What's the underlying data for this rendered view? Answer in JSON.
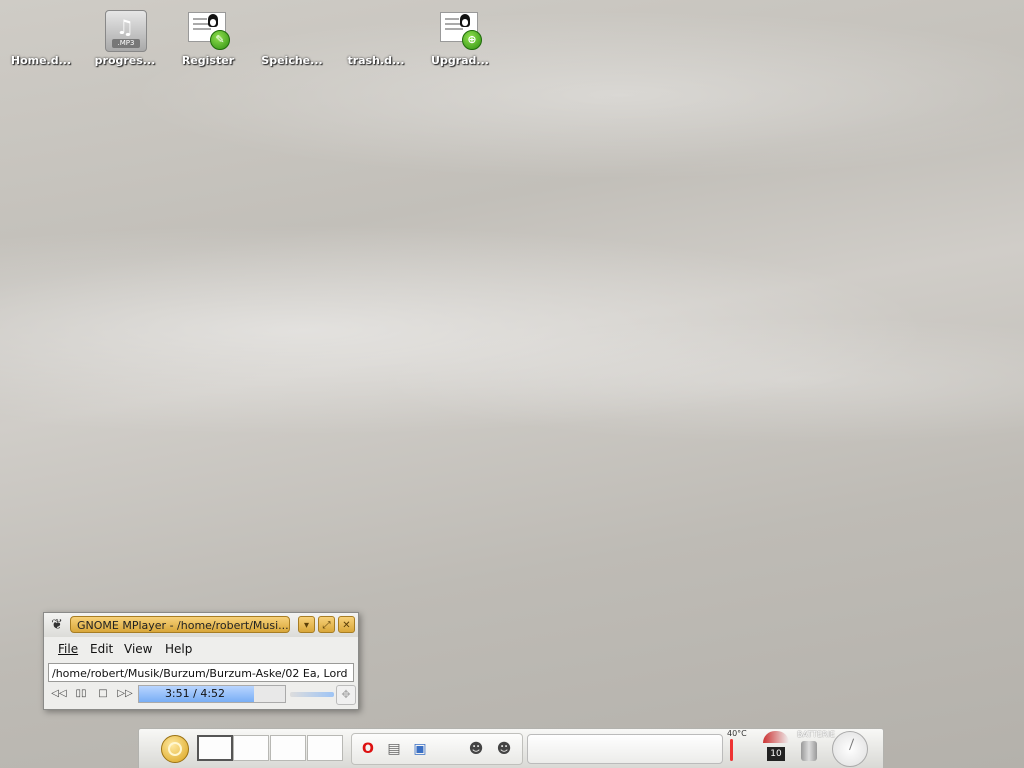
{
  "desktop": {
    "icons": [
      {
        "label": "Home.d...",
        "icon": "home-icon"
      },
      {
        "label": "progres...",
        "icon": "mp3-file-icon",
        "tag": ".MP3"
      },
      {
        "label": "Register",
        "icon": "register-icon"
      },
      {
        "label": "Speiche...",
        "icon": "storage-icon"
      },
      {
        "label": "trash.d...",
        "icon": "trash-icon"
      },
      {
        "label": "Upgrad...",
        "icon": "upgrade-icon"
      }
    ]
  },
  "mplayer": {
    "title": "GNOME MPlayer - /home/robert/Musi...",
    "menu": {
      "file": "File",
      "edit": "Edit",
      "view": "View",
      "help": "Help"
    },
    "path": "/home/robert/Musik/Burzum/Burzum-Aske/02 Ea, Lord",
    "time_display": "3:51 /  4:52",
    "progress_fraction": 0.787,
    "controls": [
      "rewind-icon",
      "pause-icon",
      "stop-icon",
      "fast-forward-icon"
    ]
  },
  "panel": {
    "temperature": "40°C",
    "gauge_value": "10",
    "battery_label": "BATTERIE",
    "colors": {
      "accent": "#d9a73a",
      "progress": "#79aef5"
    }
  }
}
